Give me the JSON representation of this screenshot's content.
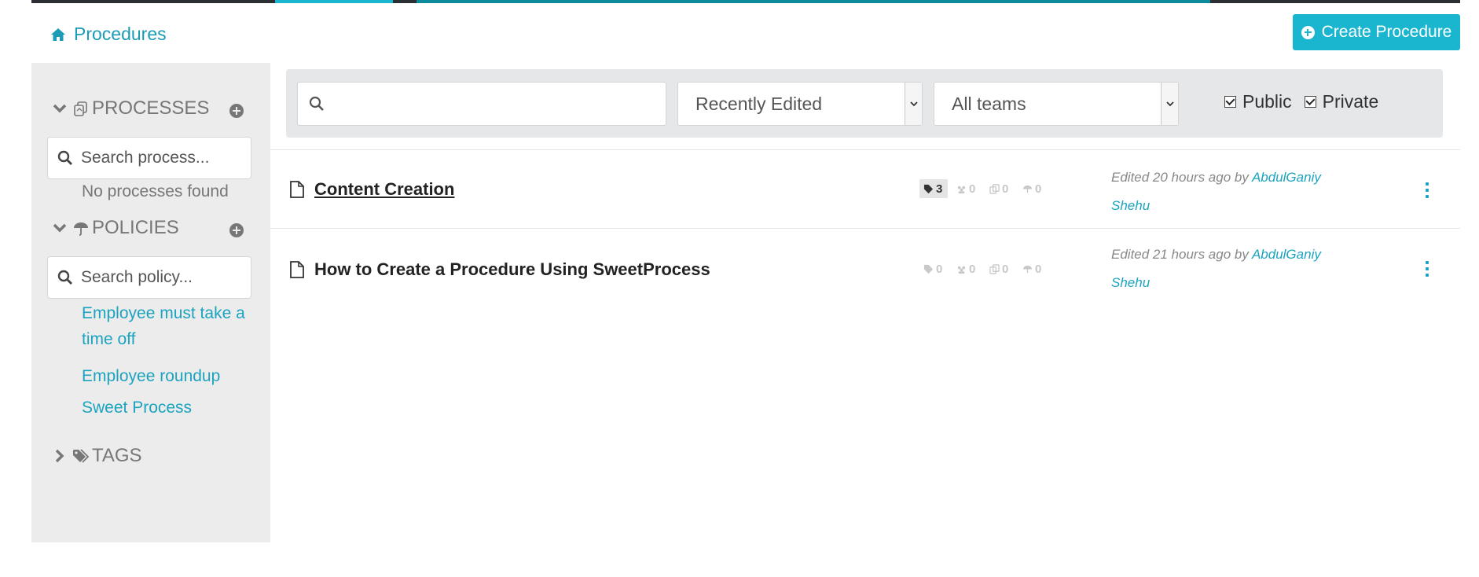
{
  "header": {
    "breadcrumb": "Procedures",
    "create_button": "Create Procedure"
  },
  "sidebar": {
    "processes": {
      "title": "PROCESSES",
      "search_placeholder": "Search process...",
      "empty_message": "No processes found"
    },
    "policies": {
      "title": "POLICIES",
      "search_placeholder": "Search policy...",
      "items": [
        {
          "label": "Employee must take a time off"
        },
        {
          "label": "Employee roundup"
        },
        {
          "label": "Sweet Process"
        }
      ]
    },
    "tags": {
      "title": "TAGS"
    }
  },
  "filters": {
    "search_value": "",
    "sort_selected": "Recently Edited",
    "team_selected": "All teams",
    "public_label": "Public",
    "public_checked": true,
    "private_label": "Private",
    "private_checked": true
  },
  "procedures": [
    {
      "title": " Content Creation",
      "tags": "3",
      "teams": "0",
      "processes": "0",
      "policies": "0",
      "edited_prefix": "Edited 20 hours ago by ",
      "author_line1": "AbdulGaniy",
      "author_line2": "Shehu"
    },
    {
      "title": "How to Create a Procedure Using SweetProcess",
      "tags": "0",
      "teams": "0",
      "processes": "0",
      "policies": "0",
      "edited_prefix": "Edited 21 hours ago by ",
      "author_line1": "AbdulGaniy",
      "author_line2": "Shehu"
    }
  ],
  "colors": {
    "accent": "#1ab6d0",
    "link": "#1ba3bf",
    "sidebar_bg": "#ececec"
  }
}
